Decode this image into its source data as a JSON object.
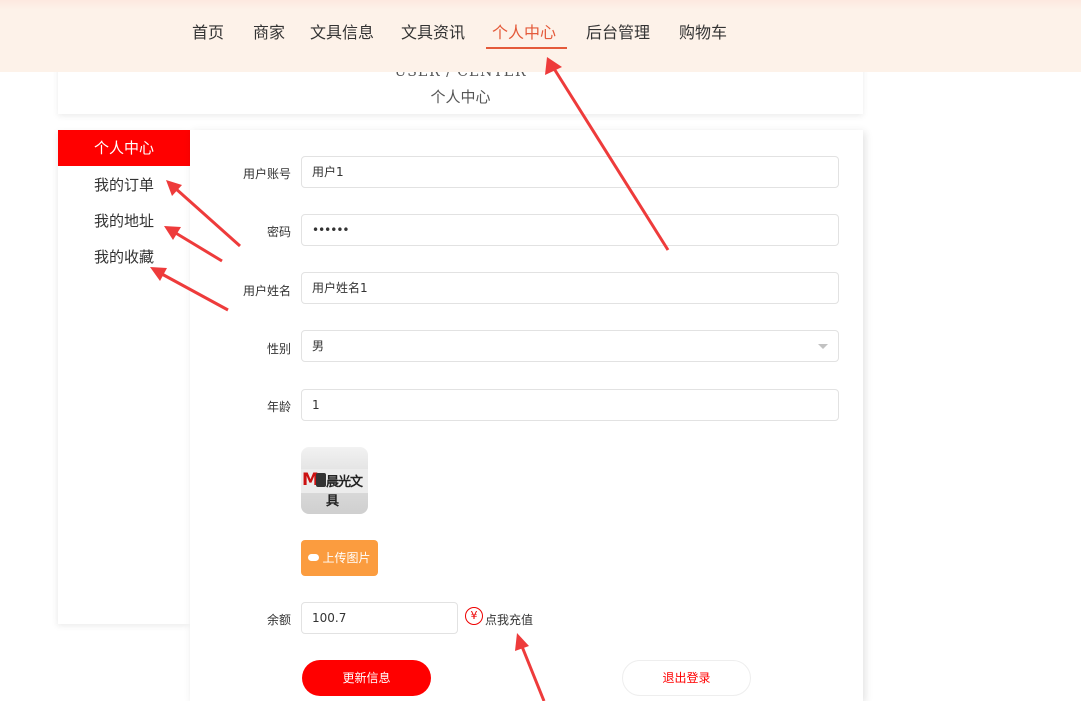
{
  "nav": {
    "items": [
      "首页",
      "商家",
      "文具信息",
      "文具资讯",
      "个人中心",
      "后台管理",
      "购物车"
    ],
    "active": "个人中心"
  },
  "header": {
    "title_en": "USER / CENTER",
    "title_cn": "个人中心"
  },
  "sidebar": {
    "items": [
      "个人中心",
      "我的订单",
      "我的地址",
      "我的收藏"
    ],
    "active": "个人中心"
  },
  "form": {
    "account_label": "用户账号",
    "account_value": "用户1",
    "password_label": "密码",
    "password_value": "••••••",
    "name_label": "用户姓名",
    "name_value": "用户姓名1",
    "gender_label": "性别",
    "gender_value": "男",
    "age_label": "年龄",
    "age_value": "1",
    "avatar_image_text": "M&G晨光文具",
    "upload_label": "上传图片",
    "balance_label": "余额",
    "balance_value": "100.7",
    "recharge_icon": "¥",
    "recharge_label": "点我充值",
    "update_label": "更新信息",
    "logout_label": "退出登录"
  },
  "colors": {
    "accent": "#ff0000",
    "nav_active": "#e45a3a",
    "upload_button": "#fb9c3f",
    "topbar_bg": "#fdf2e9",
    "annotation_arrow": "#ee3b3b"
  },
  "icons": [
    "cloud-upload-icon",
    "yen-icon",
    "select-arrow-icon",
    "annotation-arrow-icon"
  ]
}
